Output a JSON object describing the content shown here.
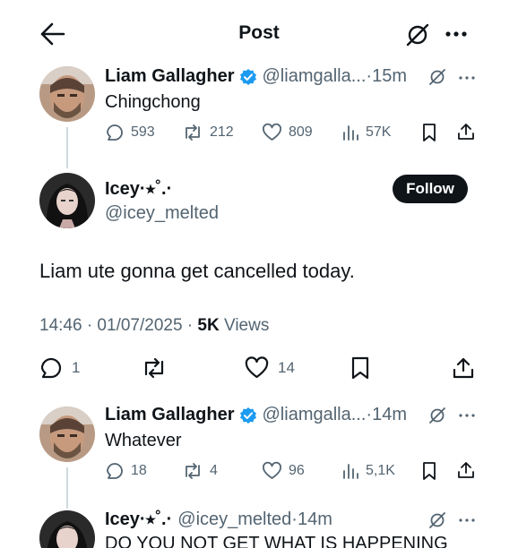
{
  "header": {
    "title": "Post"
  },
  "reply1": {
    "name": "Liam Gallagher",
    "handle": "@liamgalla...",
    "time": "15m",
    "text": "Chingchong",
    "replies": "593",
    "reposts": "212",
    "likes": "809",
    "views": "57K"
  },
  "main_post": {
    "name": "Icey·⭒˚.·",
    "handle": "@icey_melted",
    "follow_label": "Follow",
    "text": "Liam ute gonna get cancelled today.",
    "datetime": "14:46 · 01/07/2025 · ",
    "views_count": "5K",
    "views_label": " Views",
    "replies": "1",
    "likes": "14"
  },
  "reply2": {
    "name": "Liam Gallagher",
    "handle": "@liamgalla...",
    "time": "14m",
    "text": "Whatever",
    "replies": "18",
    "reposts": "4",
    "likes": "96",
    "views": "5,1K"
  },
  "reply3": {
    "name": "Icey·⭒˚.·",
    "handle": "@icey_melted",
    "time": "14m",
    "text": "DO YOU NOT GET WHAT IS HAPPENING"
  },
  "colors": {
    "verified": "#1d9bf0",
    "text": "#0f1419",
    "secondary": "#536471",
    "line": "#cfd9de"
  }
}
